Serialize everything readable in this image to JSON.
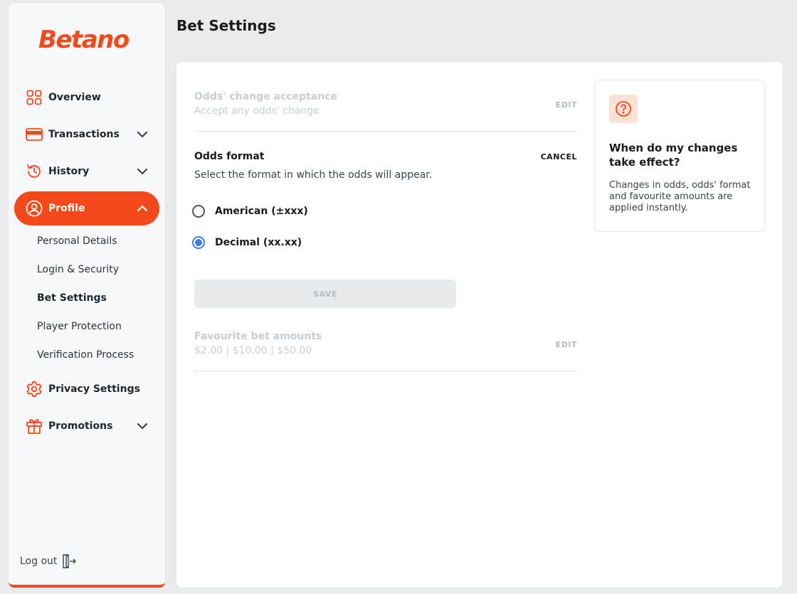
{
  "brand": {
    "logo_text": "Betano",
    "accent_color": "#f44a1b"
  },
  "sidebar": {
    "nav": [
      {
        "label": "Overview",
        "icon": "grid-icon",
        "expandable": false
      },
      {
        "label": "Transactions",
        "icon": "credit-card-icon",
        "expandable": true
      },
      {
        "label": "History",
        "icon": "history-icon",
        "expandable": true
      },
      {
        "label": "Profile",
        "icon": "user-circle-icon",
        "expandable": true,
        "active": true
      },
      {
        "label": "Privacy Settings",
        "icon": "gear-icon",
        "expandable": false
      },
      {
        "label": "Promotions",
        "icon": "gift-icon",
        "expandable": true
      }
    ],
    "profile_sub": [
      {
        "label": "Personal Details"
      },
      {
        "label": "Login & Security"
      },
      {
        "label": "Bet Settings",
        "current": true
      },
      {
        "label": "Player Protection"
      },
      {
        "label": "Verification Process"
      }
    ],
    "logout_label": "Log out"
  },
  "page": {
    "title": "Bet Settings"
  },
  "settings": {
    "odds_change": {
      "title": "Odds' change acceptance",
      "value": "Accept any odds' change",
      "edit_label": "EDIT"
    },
    "odds_format": {
      "title": "Odds format",
      "cancel_label": "CANCEL",
      "description": "Select the format in which the odds will appear.",
      "options": [
        {
          "label": "American (±xxx)",
          "checked": false
        },
        {
          "label": "Decimal (xx.xx)",
          "checked": true
        }
      ],
      "save_label": "SAVE"
    },
    "favourite_amounts": {
      "title": "Favourite bet amounts",
      "value": "$2.00 | $10.00 | $50.00",
      "edit_label": "EDIT"
    }
  },
  "info_panel": {
    "icon": "question-circle-icon",
    "title": "When do my changes take effect?",
    "body": "Changes in odds, odds' format and favourite amounts are applied instantly."
  }
}
